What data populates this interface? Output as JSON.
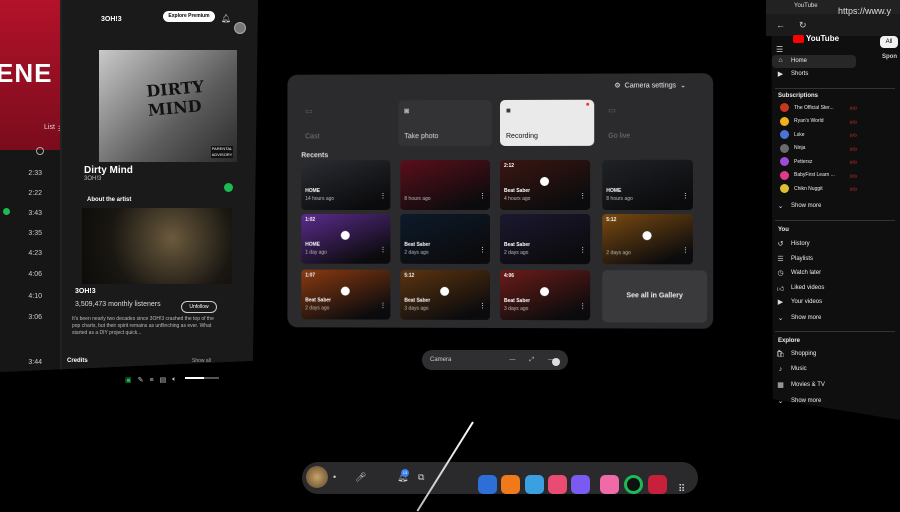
{
  "spotify": {
    "hero_title": "ENE",
    "list_label": "List",
    "durations": [
      "2:33",
      "2:22",
      "3:43",
      "3:35",
      "4:23",
      "4:06",
      "4:10",
      "3:06",
      "3:44"
    ],
    "artist_header": "3OH!3",
    "explore_premium": "Explore Premium",
    "cover_title": "DIRTY MIND",
    "cover_badge": "PARENTAL ADVISORY",
    "track_title": "Dirty Mind",
    "track_artist": "3OH!3",
    "about_label": "About the artist",
    "about_artist_name": "3OH!3",
    "monthly_listeners": "3,509,473 monthly listeners",
    "unfollow_label": "Unfollow",
    "bio": "It's been nearly two decades since 3OH!3 crashed the top of the pop charts, but their spirit remains as unflinching as ever. What started as a DIY project quick...",
    "credits_label": "Credits",
    "show_all_label": "Show all",
    "volume_fraction": 0.55,
    "accent": "#1db954",
    "hero_color": "#b3122a"
  },
  "camera": {
    "settings_label": "Camera settings",
    "modes": [
      {
        "label": "Cast",
        "icon": "cast-icon",
        "state": "dim"
      },
      {
        "label": "Take photo",
        "icon": "camera-icon",
        "state": "normal"
      },
      {
        "label": "Recording",
        "icon": "record-icon",
        "state": "selected"
      },
      {
        "label": "Go live",
        "icon": "live-icon",
        "state": "dim"
      }
    ],
    "recents_label": "Recents",
    "thumbnails": [
      {
        "duration": "",
        "label": "HOME",
        "sub": "14 hours ago",
        "play": false,
        "bg": "#2a2d33"
      },
      {
        "duration": "",
        "label": "",
        "sub": "8 hours ago",
        "play": false,
        "bg": "#5a0f1a"
      },
      {
        "duration": "2:12",
        "label": "Beat Saber",
        "sub": "4 hours ago",
        "play": true,
        "bg": "#3a1612"
      },
      {
        "duration": "",
        "label": "HOME",
        "sub": "8 hours ago",
        "play": false,
        "bg": "#1f2226"
      },
      {
        "duration": "1:02",
        "label": "HOME",
        "sub": "1 day ago",
        "play": true,
        "bg": "#5b2b8c"
      },
      {
        "duration": "",
        "label": "Beat Saber",
        "sub": "2 days ago",
        "play": false,
        "bg": "#0d1a2a"
      },
      {
        "duration": "",
        "label": "Beat Saber",
        "sub": "2 days ago",
        "play": false,
        "bg": "#1c1830"
      },
      {
        "duration": "5:12",
        "label": "",
        "sub": "2 days ago",
        "play": true,
        "bg": "#7a4a10"
      },
      {
        "duration": "1:07",
        "label": "Beat Saber",
        "sub": "2 days ago",
        "play": true,
        "bg": "#8a3a10"
      },
      {
        "duration": "5:12",
        "label": "Beat Saber",
        "sub": "3 days ago",
        "play": true,
        "bg": "#5c3410"
      },
      {
        "duration": "4:06",
        "label": "Beat Saber",
        "sub": "3 days ago",
        "play": true,
        "bg": "#6a1c18"
      }
    ],
    "see_all_label": "See all in Gallery",
    "bar_label": "Camera"
  },
  "youtube": {
    "tab_title": "YouTube",
    "url": "https://www.y",
    "logo_text": "YouTube",
    "chip_all": "All",
    "sponsored": "Spon",
    "nav": [
      {
        "label": "Home",
        "icon": "home-icon"
      },
      {
        "label": "Shorts",
        "icon": "shorts-icon"
      }
    ],
    "subscriptions_label": "Subscriptions",
    "subscriptions": [
      {
        "name": "The Official Ster...",
        "color": "#c8361f"
      },
      {
        "name": "Ryan's World",
        "color": "#f0b21a"
      },
      {
        "name": "Lske",
        "color": "#4a72d8"
      },
      {
        "name": "Ninja",
        "color": "#6a6a6a"
      },
      {
        "name": "Pettersz",
        "color": "#a04ad8"
      },
      {
        "name": "BabyFirst Learn ...",
        "color": "#e23a8a"
      },
      {
        "name": "Chikn Nuggit",
        "color": "#e0c030"
      }
    ],
    "show_more_1": "Show more",
    "you_label": "You",
    "you_items": [
      {
        "label": "History",
        "icon": "history-icon"
      },
      {
        "label": "Playlists",
        "icon": "playlist-icon"
      },
      {
        "label": "Watch later",
        "icon": "clock-icon"
      },
      {
        "label": "Liked videos",
        "icon": "thumbs-up-icon"
      },
      {
        "label": "Your videos",
        "icon": "video-icon"
      }
    ],
    "show_more_2": "Show more",
    "explore_label": "Explore",
    "explore_items": [
      {
        "label": "Shopping",
        "icon": "bag-icon"
      },
      {
        "label": "Music",
        "icon": "music-icon"
      },
      {
        "label": "Movies & TV",
        "icon": "film-icon"
      }
    ],
    "show_more_3": "Show more"
  },
  "dock": {
    "notification_count": "13",
    "apps": [
      {
        "name": "app-blue",
        "color": "#2d6fd6"
      },
      {
        "name": "app-orange",
        "color": "#f07a1a"
      },
      {
        "name": "app-blue-2",
        "color": "#3aa0e0"
      },
      {
        "name": "camera-app",
        "color": "#e94b72"
      },
      {
        "name": "app-purple",
        "color": "#7a5af0"
      },
      {
        "name": "app-pink",
        "color": "#f06aa8"
      },
      {
        "name": "spotify-app",
        "color": "#1db954"
      },
      {
        "name": "beat-saber-app",
        "color": "#c8203a"
      }
    ]
  }
}
